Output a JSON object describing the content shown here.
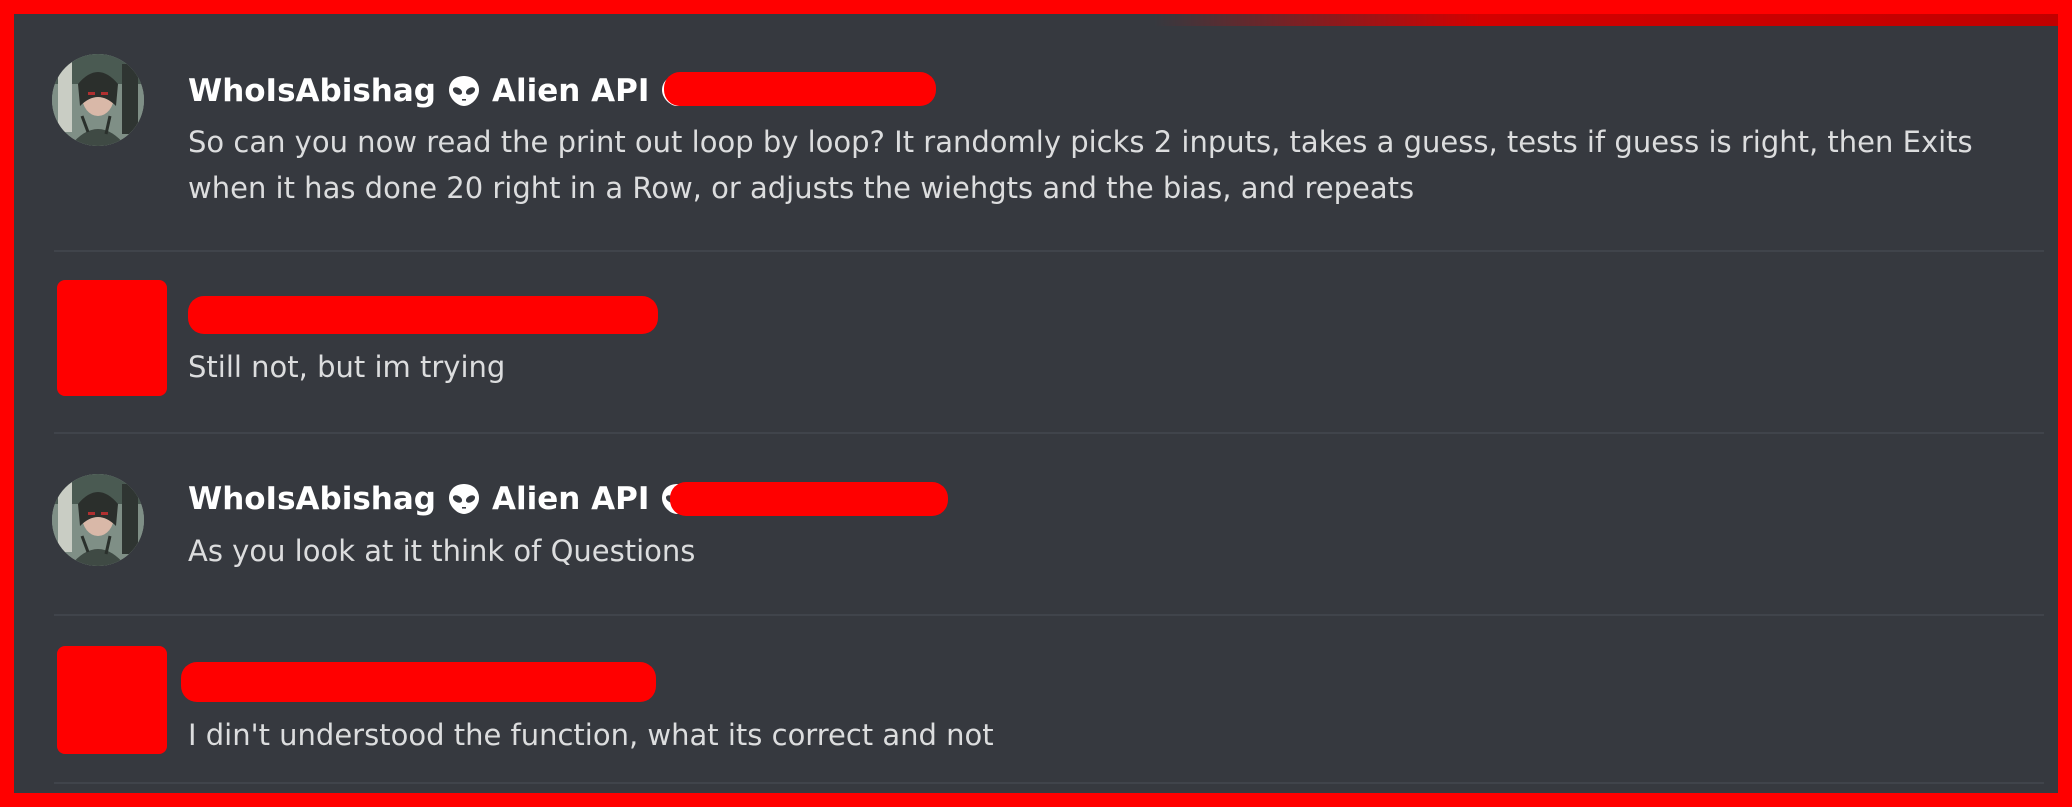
{
  "messages": [
    {
      "author": "WhoIsAbishag",
      "tag": "Alien API",
      "content": "So can you now read the print out loop by loop? It randomly picks 2 inputs, takes a guess, tests if guess is right, then Exits when it has done 20 right in a Row, or adjusts the wiehgts and the bias, and repeats"
    },
    {
      "author": "",
      "tag": "",
      "content": "Still not, but im trying"
    },
    {
      "author": "WhoIsAbishag",
      "tag": "Alien API",
      "content": "As you look at it think of Questions"
    },
    {
      "author": "",
      "tag": "",
      "content": "I din't understood the function, what its correct and not"
    }
  ],
  "colors": {
    "background": "#36393f",
    "redaction": "#ff0000",
    "text": "#dcddde",
    "author": "#ffffff"
  },
  "icons": {
    "alien": "alien-icon"
  }
}
